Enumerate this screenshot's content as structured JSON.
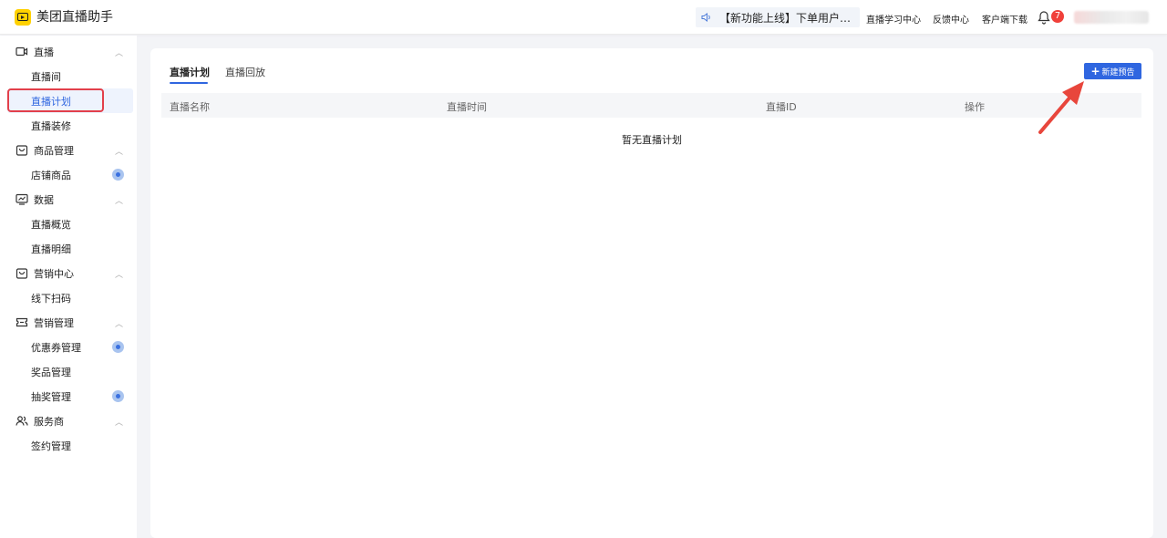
{
  "header": {
    "app_title": "美团直播助手",
    "notice": "【新功能上线】下单用户可参与...",
    "links": [
      "直播学习中心",
      "反馈中心",
      "客户端下载"
    ],
    "notification_count": "7",
    "user_name": ""
  },
  "sidebar": {
    "groups": [
      {
        "label": "直播",
        "icon": "video-camera-icon",
        "items": [
          "直播间",
          "直播计划",
          "直播装修"
        ]
      },
      {
        "label": "商品管理",
        "icon": "shopping-bag-icon",
        "items": [
          "店铺商品"
        ]
      },
      {
        "label": "数据",
        "icon": "chart-monitor-icon",
        "items": [
          "直播概览",
          "直播明细"
        ]
      },
      {
        "label": "营销中心",
        "icon": "shopping-bag-icon",
        "items": [
          "线下扫码"
        ]
      },
      {
        "label": "营销管理",
        "icon": "ticket-icon",
        "items": [
          "优惠券管理",
          "奖品管理",
          "抽奖管理"
        ]
      },
      {
        "label": "服务商",
        "icon": "users-icon",
        "items": [
          "签约管理"
        ]
      }
    ],
    "active_item": "直播计划"
  },
  "main": {
    "tabs": [
      "直播计划",
      "直播回放"
    ],
    "new_button": "新建预告",
    "columns": [
      "直播名称",
      "直播时间",
      "直播ID",
      "操作"
    ],
    "empty_text": "暂无直播计划"
  },
  "colors": {
    "accent": "#2f66e0",
    "annotation": "#e2404b",
    "badge": "#f0403a",
    "logo": "#ffd100"
  }
}
